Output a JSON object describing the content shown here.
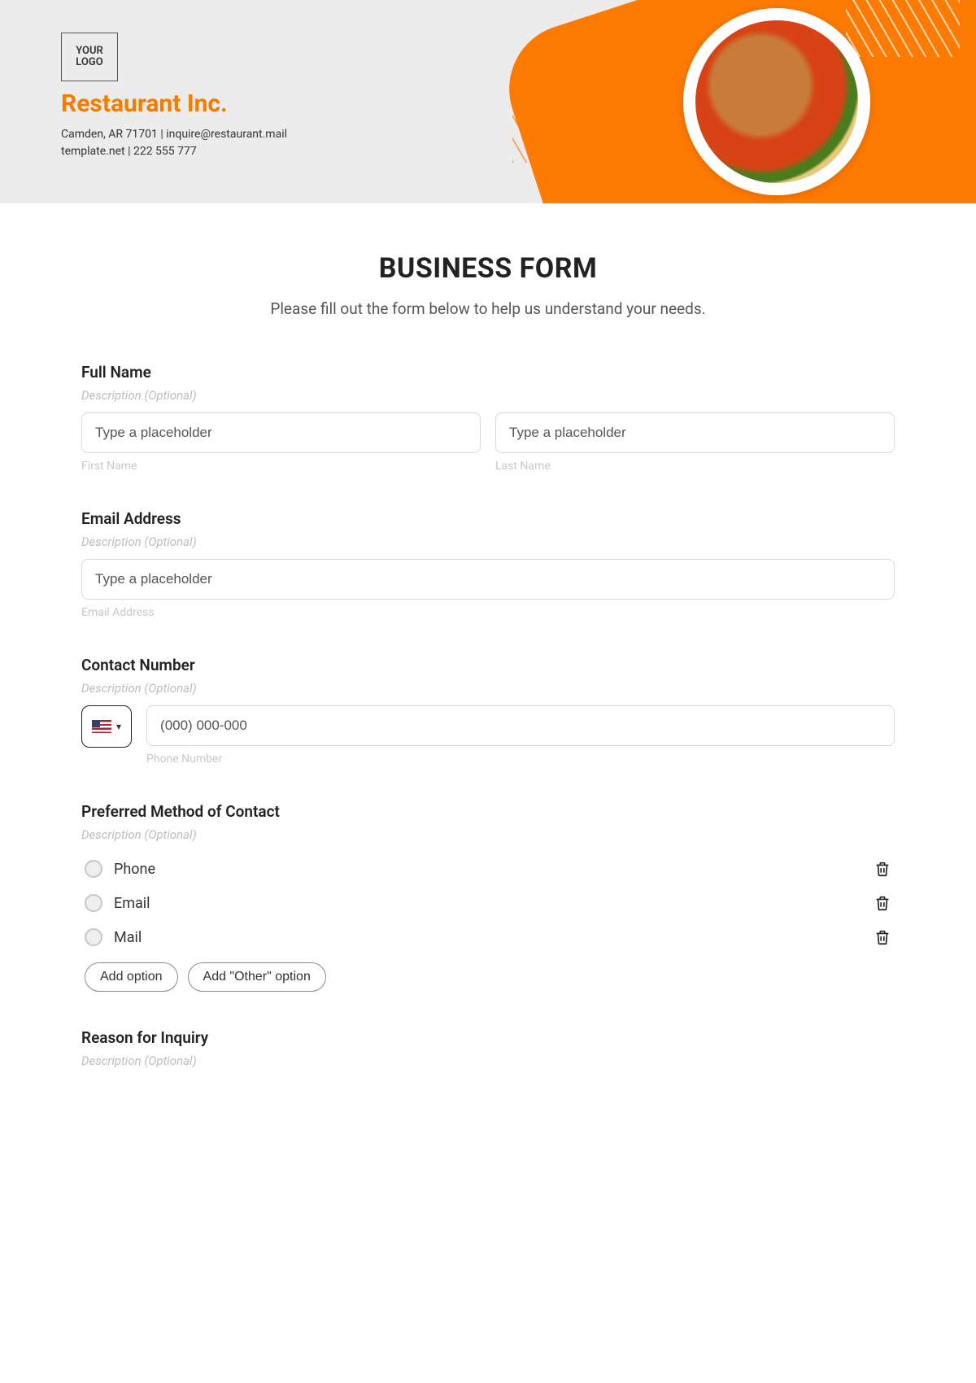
{
  "header": {
    "logo_text": "YOUR LOGO",
    "company": "Restaurant Inc.",
    "address_line": "Camden, AR 71701 | inquire@restaurant.mail",
    "contact_line": "template.net | 222 555 777"
  },
  "form": {
    "title": "BUSINESS FORM",
    "subtitle": "Please fill out the form below to help us understand your needs.",
    "full_name": {
      "label": "Full Name",
      "desc": "Description (Optional)",
      "first_placeholder": "Type a placeholder",
      "last_placeholder": "Type a placeholder",
      "first_sub": "First Name",
      "last_sub": "Last Name"
    },
    "email": {
      "label": "Email Address",
      "desc": "Description (Optional)",
      "placeholder": "Type a placeholder",
      "sub": "Email Address"
    },
    "phone": {
      "label": "Contact Number",
      "desc": "Description (Optional)",
      "placeholder": "(000) 000-000",
      "sub": "Phone Number"
    },
    "contact_method": {
      "label": "Preferred Method of Contact",
      "desc": "Description (Optional)",
      "options": [
        "Phone",
        "Email",
        "Mail"
      ],
      "add_option": "Add option",
      "add_other": "Add \"Other\" option"
    },
    "reason": {
      "label": "Reason for Inquiry",
      "desc": "Description (Optional)"
    }
  }
}
